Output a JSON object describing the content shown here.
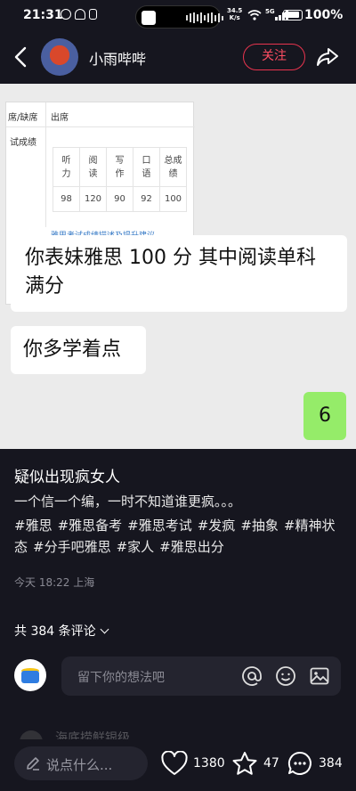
{
  "status_bar": {
    "time": "21:31",
    "net_speed_value": "34.5",
    "net_speed_unit": "K/s",
    "network": "5G",
    "battery": "100%"
  },
  "header": {
    "author_name": "小雨哔哔",
    "follow_label": "关注"
  },
  "image": {
    "score_card": {
      "row1_label": "席/缺席",
      "row1_value": "出席",
      "row2_label": "试成绩",
      "columns": [
        "听\n力",
        "阅\n读",
        "写\n作",
        "口\n语",
        "总成\n绩"
      ],
      "scores": [
        "98",
        "120",
        "90",
        "92",
        "100"
      ],
      "link_text": "雅思考试成绩描述及提升建议"
    },
    "bubble1": "你表妹雅思 100 分 其中阅读单科满分",
    "bubble2": "你多学着点",
    "bubble3": "6"
  },
  "post": {
    "title": "疑似出现疯女人",
    "description": "一个信一个编，一时不知道谁更疯。。。",
    "tags": [
      "#雅思",
      "#雅思备考",
      "#雅思考试",
      "#发疯",
      "#抽象",
      "#精神状态",
      "#分手吧雅思",
      "#家人",
      "#雅思出分"
    ],
    "meta": "今天 18:22 上海"
  },
  "comments": {
    "count_label": "共 384 条评论",
    "input_placeholder": "留下你的想法吧",
    "faded_preview": "海底捞鲜银级"
  },
  "bottom_bar": {
    "say_placeholder": "说点什么...",
    "likes": "1380",
    "favorites": "47",
    "comments": "384"
  },
  "colors": {
    "background": "#16161f",
    "accent": "#e8344e",
    "bubble_green": "#95ec69"
  }
}
